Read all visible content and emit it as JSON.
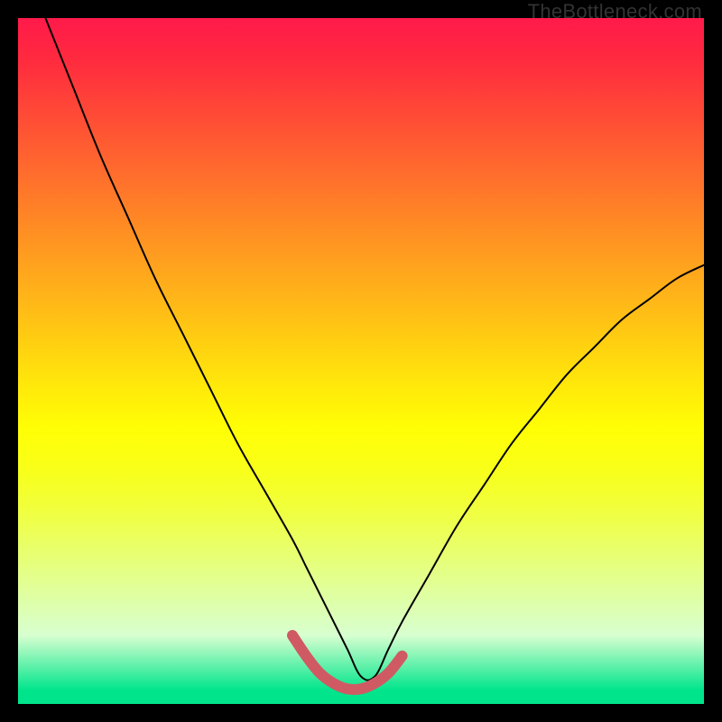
{
  "watermark": "TheBottleneck.com",
  "chart_data": {
    "type": "line",
    "title": "",
    "xlabel": "",
    "ylabel": "",
    "xlim": [
      0,
      100
    ],
    "ylim": [
      0,
      100
    ],
    "series": [
      {
        "name": "bottleneck-curve",
        "color": "#000000",
        "width": 2,
        "x": [
          4,
          8,
          12,
          16,
          20,
          24,
          28,
          32,
          36,
          40,
          42,
          44,
          46,
          48,
          50,
          52,
          54,
          56,
          60,
          64,
          68,
          72,
          76,
          80,
          84,
          88,
          92,
          96,
          100
        ],
        "y": [
          100,
          90,
          80,
          71,
          62,
          54,
          46,
          38,
          31,
          24,
          20,
          16,
          12,
          8,
          4,
          4,
          8,
          12,
          19,
          26,
          32,
          38,
          43,
          48,
          52,
          56,
          59,
          62,
          64
        ]
      },
      {
        "name": "optimal-range",
        "color": "#d05a63",
        "width": 12,
        "x": [
          40,
          42,
          44,
          46,
          48,
          50,
          52,
          54,
          56
        ],
        "y": [
          10,
          7,
          4.5,
          3,
          2.2,
          2.2,
          3,
          4.5,
          7
        ]
      }
    ]
  }
}
